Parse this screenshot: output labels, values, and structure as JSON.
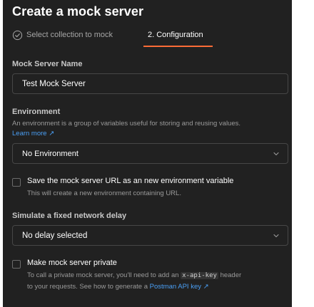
{
  "title": "Create a mock server",
  "tabs": {
    "step1_label": "Select collection to mock",
    "step2_label": "2. Configuration"
  },
  "mock_server_name": {
    "label": "Mock Server Name",
    "value": "Test Mock Server"
  },
  "environment": {
    "label": "Environment",
    "help": "An environment is a group of variables useful for storing and reusing values.",
    "learn_more": "Learn more ↗",
    "selected": "No Environment"
  },
  "save_url": {
    "label": "Save the mock server URL as an new environment variable",
    "help": "This will create a new environment containing URL."
  },
  "delay": {
    "label": "Simulate a fixed network delay",
    "selected": "No delay selected"
  },
  "private": {
    "label": "Make mock server private",
    "help_part1": "To call a private mock server, you'll need to add an ",
    "help_code": "x-api-key",
    "help_part2": " header",
    "help_line2": "to your requests. See how to generate a ",
    "help_link": "Postman API key ↗"
  },
  "colors": {
    "background": "#212121",
    "accent": "#ff6c37",
    "link": "#4a9ff5"
  }
}
